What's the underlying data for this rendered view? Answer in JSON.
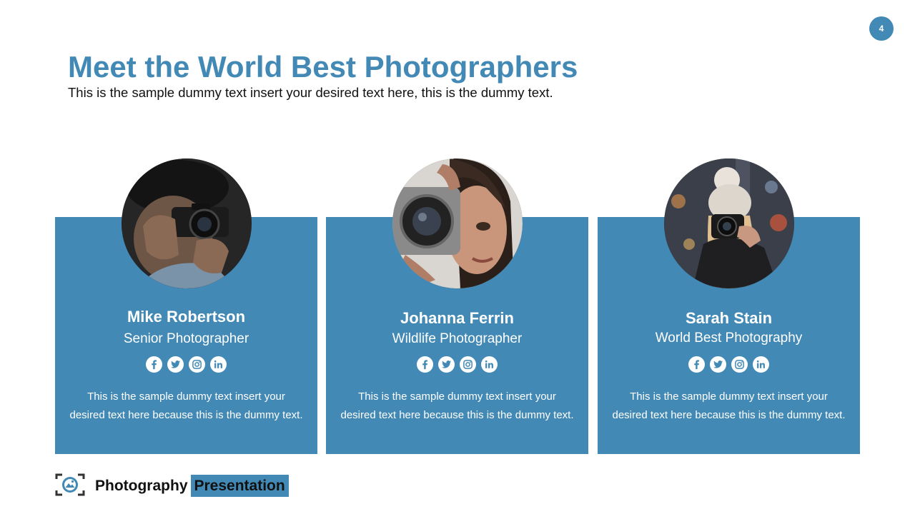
{
  "page_number": "4",
  "title": "Meet the World Best Photographers",
  "subtitle": "This is the sample dummy text insert your desired text here, this is the dummy text.",
  "cards": [
    {
      "name": "Mike Robertson",
      "role": "Senior Photographer",
      "description": "This is the sample dummy text insert your desired text here because this is the dummy text."
    },
    {
      "name": "Johanna Ferrin",
      "role": "Wildlife Photographer",
      "description": "This is the sample dummy text insert your desired text here because this is the dummy text."
    },
    {
      "name": "Sarah Stain",
      "role": "World Best Photography",
      "description": "This is the sample dummy text insert your desired text here because this is the dummy text."
    }
  ],
  "social_icons": [
    "facebook-icon",
    "twitter-icon",
    "instagram-icon",
    "linkedin-icon"
  ],
  "footer": {
    "brand": "Photography",
    "highlight": "Presentation"
  },
  "colors": {
    "accent": "#4289b5",
    "text": "#111111",
    "card_text": "#ffffff"
  }
}
